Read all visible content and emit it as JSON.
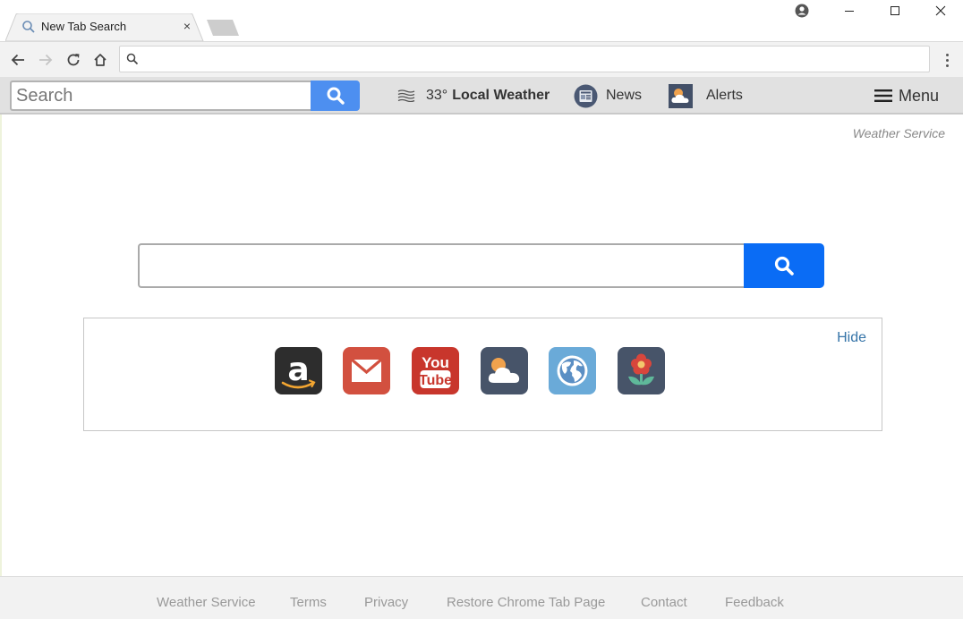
{
  "browser": {
    "tab": {
      "title": "New Tab Search",
      "icon": "search-icon",
      "close": "×"
    },
    "window_controls": [
      "profile-icon",
      "minimize-icon",
      "maximize-icon",
      "close-icon"
    ],
    "omnibox": {
      "value": "",
      "placeholder": ""
    }
  },
  "extension_bar": {
    "search_placeholder": "Search",
    "weather": {
      "temp": "33°",
      "label": "Local Weather",
      "icon": "wind-icon"
    },
    "news": {
      "label": "News",
      "icon": "newspaper-icon"
    },
    "alerts": {
      "label": "Alerts",
      "icon": "cloud-sun-icon"
    },
    "menu": {
      "label": "Menu",
      "icon": "hamburger-icon"
    }
  },
  "main": {
    "brand": "Weather Service",
    "search": {
      "value": "",
      "placeholder": ""
    },
    "quicklinks": {
      "hide_label": "Hide",
      "tiles": [
        {
          "name": "Amazon",
          "icon": "amazon-icon",
          "color": "#2d2d2d"
        },
        {
          "name": "Gmail",
          "icon": "mail-icon",
          "color": "#d2503f"
        },
        {
          "name": "YouTube",
          "icon": "youtube-icon",
          "color": "#c8362c"
        },
        {
          "name": "Weather",
          "icon": "weather-icon",
          "color": "#475469"
        },
        {
          "name": "Web",
          "icon": "globe-icon",
          "color": "#6aaad8"
        },
        {
          "name": "Flowers",
          "icon": "flower-icon",
          "color": "#475469"
        }
      ]
    }
  },
  "footer": {
    "links": [
      "Weather Service",
      "Terms",
      "Privacy",
      "Restore Chrome Tab Page",
      "Contact",
      "Feedback"
    ]
  },
  "colors": {
    "primary_button": "#0a6cf5",
    "ext_button": "#4d8ff0",
    "link": "#3574a8"
  }
}
